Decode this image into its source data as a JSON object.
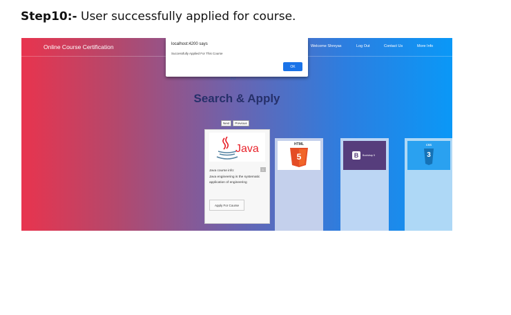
{
  "doc": {
    "step_label": "Step10:-",
    "step_text": " User successfully applied for course."
  },
  "app": {
    "brand": "Online Course Certification",
    "nav": [
      "Welcome Shreyas",
      "Log Out",
      "Contact Us",
      "More Info"
    ]
  },
  "dialog": {
    "title": "localhost:4200 says",
    "message": "Successfully Applied For This Course",
    "ok_label": "OK"
  },
  "page": {
    "heading": "Search & Apply",
    "tilde": "∾",
    "next_label": "Next",
    "prev_label": "Previous"
  },
  "course_card": {
    "image_text": "Java",
    "number": "1",
    "info_title": "Java course info:",
    "info_text": "Java engineering is the systematic application of engineering",
    "apply_label": "Apply For Course"
  },
  "side_cards": {
    "html_label": "HTML",
    "html_badge": "5",
    "bootstrap_badge": "B",
    "bootstrap_label": "Bootstrap 5",
    "css_label": "CSS",
    "css_badge": "3"
  },
  "colors": {
    "gradient_start": "#e8344e",
    "gradient_end": "#0a98f7",
    "heading": "#26306a",
    "ok_button": "#1a73e8",
    "java_red": "#e8222a",
    "java_blue": "#5382a1"
  }
}
